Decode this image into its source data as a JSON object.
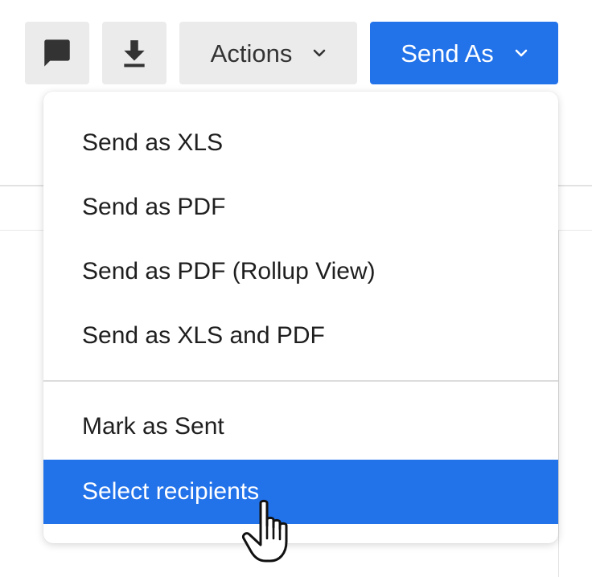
{
  "toolbar": {
    "comment_icon": "comment-icon",
    "download_icon": "download-icon",
    "actions_label": "Actions",
    "send_as_label": "Send As",
    "accent_color": "#2272ea"
  },
  "menu": {
    "items": [
      {
        "label": "Send as XLS",
        "selected": false
      },
      {
        "label": "Send as PDF",
        "selected": false
      },
      {
        "label": "Send as PDF (Rollup View)",
        "selected": false
      },
      {
        "label": "Send as XLS and PDF",
        "selected": false
      },
      {
        "label": "Mark as Sent",
        "selected": false
      },
      {
        "label": "Select recipients",
        "selected": true
      }
    ]
  },
  "cursor": "hand-pointer-icon"
}
